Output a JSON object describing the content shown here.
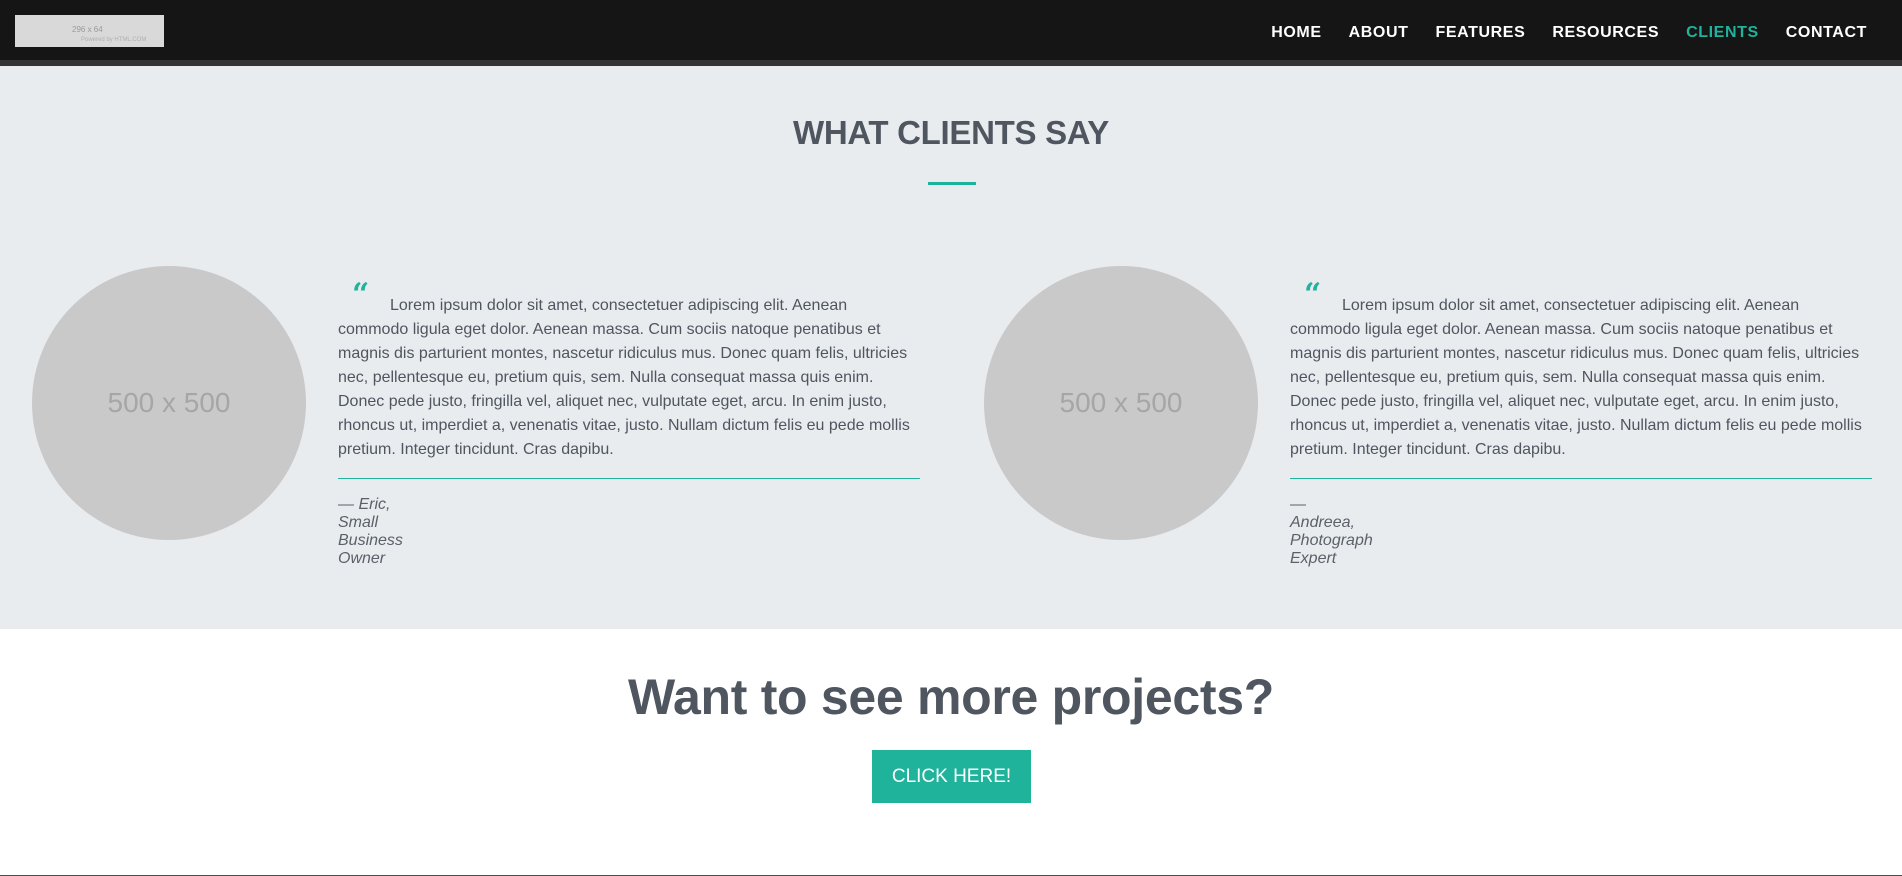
{
  "header": {
    "logo": {
      "size_text": "296 x 64",
      "powered_text": "Powered by HTML.COM"
    },
    "nav": [
      {
        "label": "HOME",
        "active": false
      },
      {
        "label": "ABOUT",
        "active": false
      },
      {
        "label": "FEATURES",
        "active": false
      },
      {
        "label": "RESOURCES",
        "active": false
      },
      {
        "label": "CLIENTS",
        "active": true
      },
      {
        "label": "CONTACT",
        "active": false
      }
    ]
  },
  "testimonials": {
    "title": "WHAT CLIENTS SAY",
    "items": [
      {
        "avatar_text": "500 x 500",
        "quote_mark": "“",
        "text": "Lorem ipsum dolor sit amet, consectetuer adipiscing elit. Aenean commodo ligula eget dolor. Aenean massa. Cum sociis natoque penatibus et magnis dis parturient montes, nascetur ridiculus mus. Donec quam felis, ultricies nec, pellentesque eu, pretium quis, sem. Nulla consequat massa quis enim. Donec pede justo, fringilla vel, aliquet nec, vulputate eget, arcu. In enim justo, rhoncus ut, imperdiet a, venenatis vitae, justo. Nullam dictum felis eu pede mollis pretium. Integer tincidunt. Cras dapibu.",
        "author": "— Eric, Small Business Owner"
      },
      {
        "avatar_text": "500 x 500",
        "quote_mark": "“",
        "text": "Lorem ipsum dolor sit amet, consectetuer adipiscing elit. Aenean commodo ligula eget dolor. Aenean massa. Cum sociis natoque penatibus et magnis dis parturient montes, nascetur ridiculus mus. Donec quam felis, ultricies nec, pellentesque eu, pretium quis, sem. Nulla consequat massa quis enim. Donec pede justo, fringilla vel, aliquet nec, vulputate eget, arcu. In enim justo, rhoncus ut, imperdiet a, venenatis vitae, justo. Nullam dictum felis eu pede mollis pretium. Integer tincidunt. Cras dapibu.",
        "author": "— Andreea, Photograph Expert"
      }
    ]
  },
  "cta": {
    "title": "Want to see more projects?",
    "button_label": "CLICK HERE!"
  },
  "colors": {
    "accent": "#1fb39b",
    "navbar": "#151515",
    "section_bg": "#e8ecef",
    "text": "#4f5660"
  }
}
